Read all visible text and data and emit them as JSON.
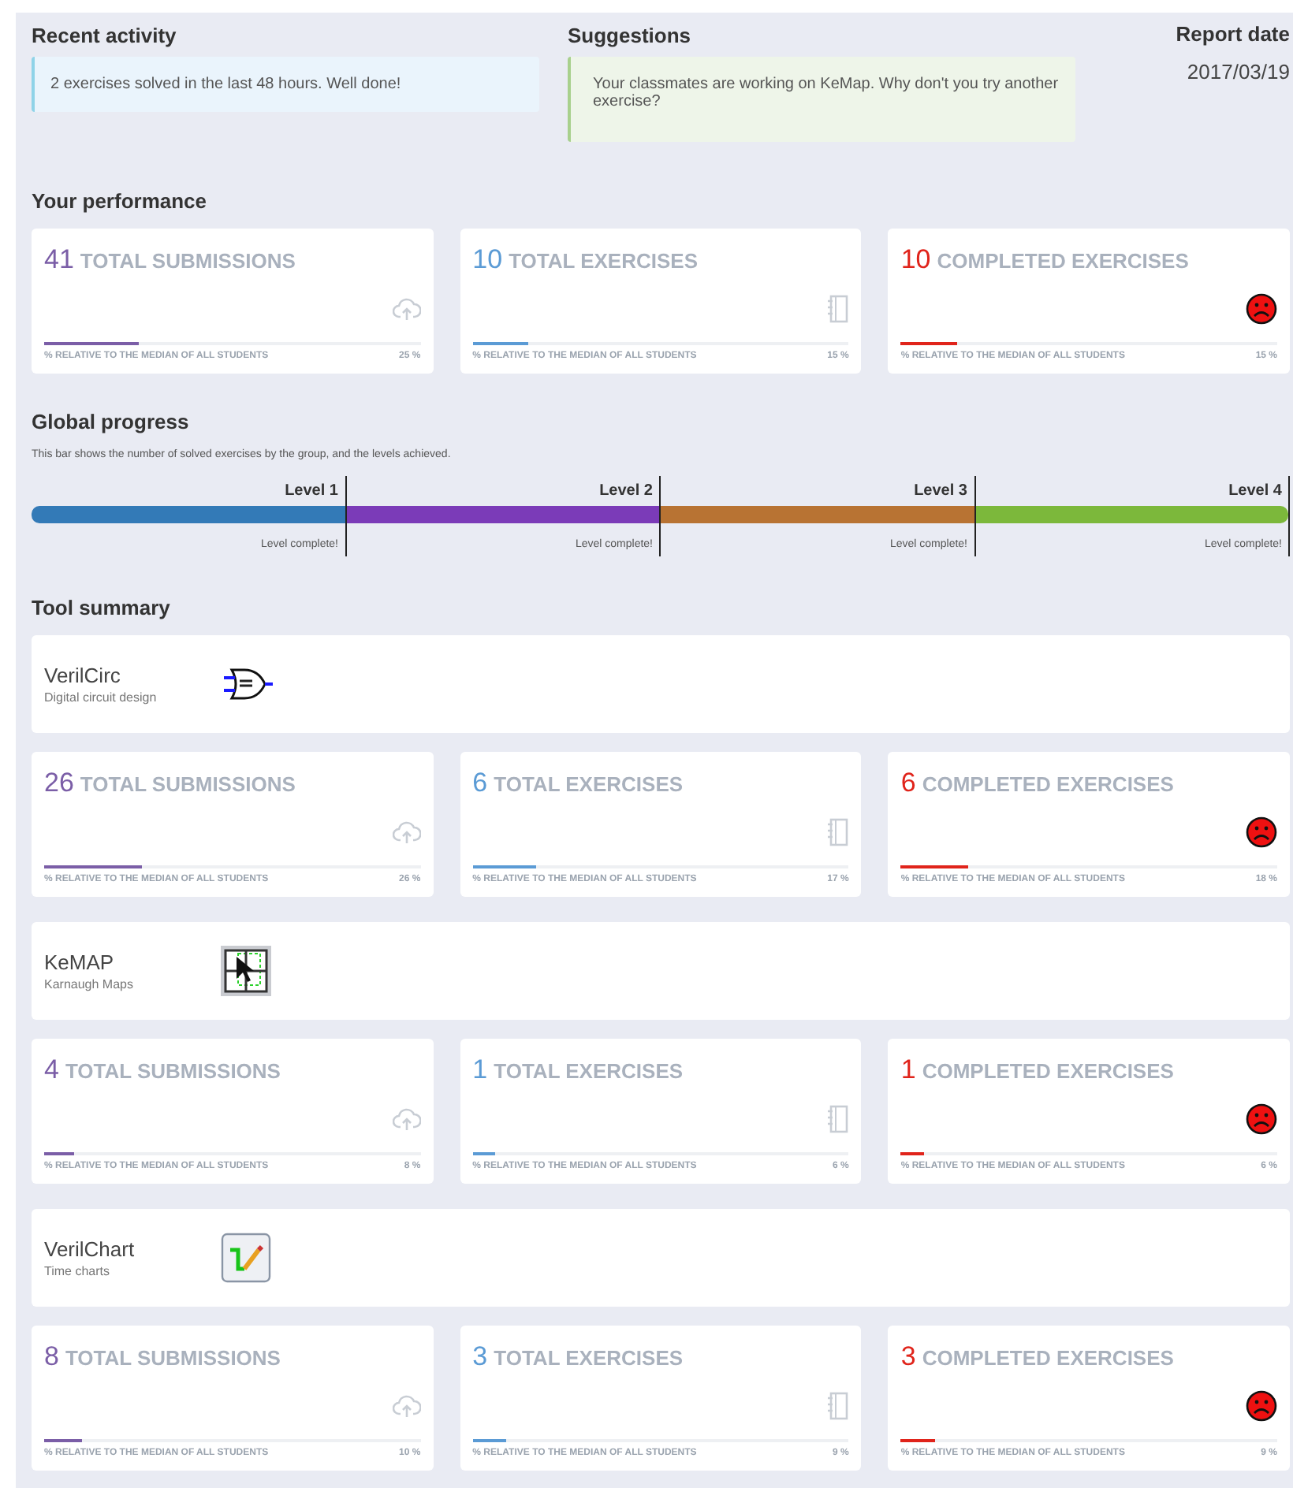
{
  "recent_activity": {
    "title": "Recent activity",
    "message": "2 exercises solved in the last 48 hours. Well done!"
  },
  "suggestions": {
    "title": "Suggestions",
    "message": "Your classmates are working on KeMap. Why don't you try another exercise?"
  },
  "report_date": {
    "label": "Report date",
    "value": "2017/03/19"
  },
  "performance": {
    "title": "Your performance",
    "stats": [
      {
        "kind": "submissions",
        "count": "41",
        "label": "TOTAL SUBMISSIONS",
        "footer": "% RELATIVE TO THE MEDIAN OF ALL STUDENTS",
        "percent": "25 %",
        "level": 0.25
      },
      {
        "kind": "exercises",
        "count": "10",
        "label": "TOTAL EXERCISES",
        "footer": "% RELATIVE TO THE MEDIAN OF ALL STUDENTS",
        "percent": "15 %",
        "level": 0.15
      },
      {
        "kind": "completed",
        "count": "10",
        "label": "COMPLETED EXERCISES",
        "footer": "% RELATIVE TO THE MEDIAN OF ALL STUDENTS",
        "percent": "15 %",
        "level": 0.15
      }
    ]
  },
  "global_progress": {
    "title": "Global progress",
    "description": "This bar shows the number of solved exercises by the group, and the levels achieved.",
    "levels": [
      {
        "label": "Level 1",
        "status": "Level complete!",
        "color": "#337ab7"
      },
      {
        "label": "Level 2",
        "status": "Level complete!",
        "color": "#7b3bb8"
      },
      {
        "label": "Level 3",
        "status": "Level complete!",
        "color": "#b87333"
      },
      {
        "label": "Level 4",
        "status": "Level complete!",
        "color": "#7cb83b"
      }
    ]
  },
  "tool_summary": {
    "title": "Tool summary",
    "tools": [
      {
        "kind": "circuit",
        "name": "VerilCirc",
        "subtitle": "Digital circuit design",
        "stats": [
          {
            "kind": "submissions",
            "count": "26",
            "label": "TOTAL SUBMISSIONS",
            "footer": "% RELATIVE TO THE MEDIAN OF ALL STUDENTS",
            "percent": "26 %",
            "level": 0.26
          },
          {
            "kind": "exercises",
            "count": "6",
            "label": "TOTAL EXERCISES",
            "footer": "% RELATIVE TO THE MEDIAN OF ALL STUDENTS",
            "percent": "17 %",
            "level": 0.17
          },
          {
            "kind": "completed",
            "count": "6",
            "label": "COMPLETED EXERCISES",
            "footer": "% RELATIVE TO THE MEDIAN OF ALL STUDENTS",
            "percent": "18 %",
            "level": 0.18
          }
        ]
      },
      {
        "kind": "map",
        "name": "KeMAP",
        "subtitle": "Karnaugh Maps",
        "stats": [
          {
            "kind": "submissions",
            "count": "4",
            "label": "TOTAL SUBMISSIONS",
            "footer": "% RELATIVE TO THE MEDIAN OF ALL STUDENTS",
            "percent": "8 %",
            "level": 0.08
          },
          {
            "kind": "exercises",
            "count": "1",
            "label": "TOTAL EXERCISES",
            "footer": "% RELATIVE TO THE MEDIAN OF ALL STUDENTS",
            "percent": "6 %",
            "level": 0.06
          },
          {
            "kind": "completed",
            "count": "1",
            "label": "COMPLETED EXERCISES",
            "footer": "% RELATIVE TO THE MEDIAN OF ALL STUDENTS",
            "percent": "6 %",
            "level": 0.06
          }
        ]
      },
      {
        "kind": "chart",
        "name": "VerilChart",
        "subtitle": "Time charts",
        "stats": [
          {
            "kind": "submissions",
            "count": "8",
            "label": "TOTAL SUBMISSIONS",
            "footer": "% RELATIVE TO THE MEDIAN OF ALL STUDENTS",
            "percent": "10 %",
            "level": 0.1
          },
          {
            "kind": "exercises",
            "count": "3",
            "label": "TOTAL EXERCISES",
            "footer": "% RELATIVE TO THE MEDIAN OF ALL STUDENTS",
            "percent": "9 %",
            "level": 0.09
          },
          {
            "kind": "completed",
            "count": "3",
            "label": "COMPLETED EXERCISES",
            "footer": "% RELATIVE TO THE MEDIAN OF ALL STUDENTS",
            "percent": "9 %",
            "level": 0.09
          }
        ]
      }
    ]
  }
}
